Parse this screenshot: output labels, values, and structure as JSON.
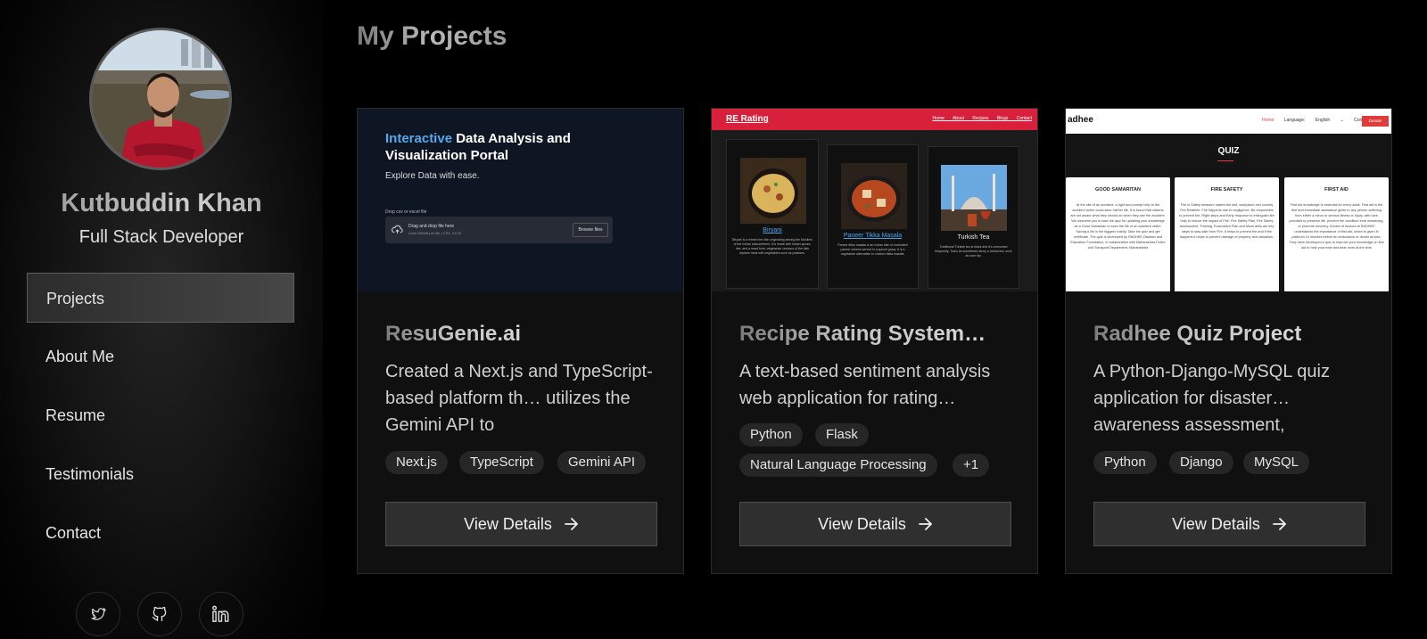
{
  "profile": {
    "name": "Kutbuddin Khan",
    "role": "Full Stack Developer"
  },
  "nav": {
    "items": [
      {
        "label": "Projects",
        "active": true
      },
      {
        "label": "About Me",
        "active": false
      },
      {
        "label": "Resume",
        "active": false
      },
      {
        "label": "Testimonials",
        "active": false
      },
      {
        "label": "Contact",
        "active": false
      }
    ]
  },
  "social": [
    "twitter-icon",
    "github-icon",
    "linkedin-icon"
  ],
  "main": {
    "title": "My Projects",
    "view_label": "View Details",
    "cards": [
      {
        "title": "ResuGenie.ai",
        "description": "Created a Next.js and TypeScript-based platform th… utilizes the Gemini API to",
        "tags": [
          "Next.js",
          "TypeScript",
          "Gemini API"
        ],
        "thumb": {
          "heading_accent": "Interactive",
          "heading_line1": " Data Analysis and",
          "heading_line2": "Visualization Portal",
          "subtitle": "Explore Data with ease.",
          "drop_label": "Drop csv or excel file",
          "drop_text": "Drag and drop file here",
          "drop_limit": "Limit 200MB per file • CSV, XLSX",
          "browse": "Browse files"
        }
      },
      {
        "title": "Recipe Rating System…",
        "description": "A text-based sentiment analysis web application for rating…",
        "tags": [
          "Python",
          "Flask",
          "Natural Language Processing",
          "+1"
        ],
        "thumb": {
          "brand": "RE Rating",
          "links": "Home About Recipes Blogs Contact",
          "recipes": [
            {
              "name": "Biryani",
              "text": "Biryani is a mixed rice dish originating among the Muslims of the Indian subcontinent. It is made with Indian spices, rice, and a meat form; vegetarian versions of the dish replace meat with vegetables such as potatoes."
            },
            {
              "name": "Paneer Tikka Masala",
              "text": "Paneer tikka masala is an Indian dish of marinated paneer cheese served in a spiced gravy. It is a vegetarian alternative to chicken tikka masala."
            },
            {
              "name": "Turkish Tea",
              "text": "Traditional Turkish tea is black and it's consumed frequently. Turks do sometimes fancy a herbal tea, such as rose hip."
            }
          ]
        }
      },
      {
        "title": "Radhee Quiz Project",
        "description": "A Python-Django-MySQL quiz application for disaster… awareness assessment,",
        "tags": [
          "Python",
          "Django",
          "MySQL"
        ],
        "thumb": {
          "logo": "adhee",
          "links_home": "Home",
          "links_rest": "Language: English ⌄ Contact",
          "donate": "Donate",
          "heading": "QUIZ",
          "quizzes": [
            {
              "title": "GOOD SAMARITAN",
              "text": "At the site of an accident, a right and prompt help to the accident victim could save his/her life. It is found that citizens are not aware what they should do when they see the accident. We welcome you to take the quiz for updating your knowledge as a Good Samaritan to save the life of an accident victim. Saving a life is the biggest charity. Take the quiz and get certificate. The quiz is developed by RADHEE Disaster and Education Foundation, in collaboration with Maharashtra Police and Transport Department, Maharashtra"
            },
            {
              "title": "FIRE SAFETY",
              "text": "Fire is Safety measure makes the self, workplace and country Fire Resilient. Fire happens due to negligence. Be responsible to prevent fire. Right steps and Early response to extinguish fire help to reduce the impact of Fire. Fire Safety Plan, Fire Safety Assessment, Training, Evacuation Plan and Mock drills are key steps to stay safe from Fire. It helps to prevent fire and if fire happens it helps to prevent damage of property and valuables."
            },
            {
              "title": "FIRST AID",
              "text": "First Aid knowledge is essential for every adult. First aid is the first and immediate assistance given to any person suffering from either a minor or serious illness or injury, with care provided to preserve life, prevent the condition from worsening, or promote recovery. A team of doctors at RADHEE understands the importance of first aid, which is given in platinum 10 minutes before an ambulance or doctor arrives. They have developed a quiz to improve your knowledge on first aid to help your near and dear ones at the time"
            }
          ]
        }
      }
    ]
  }
}
